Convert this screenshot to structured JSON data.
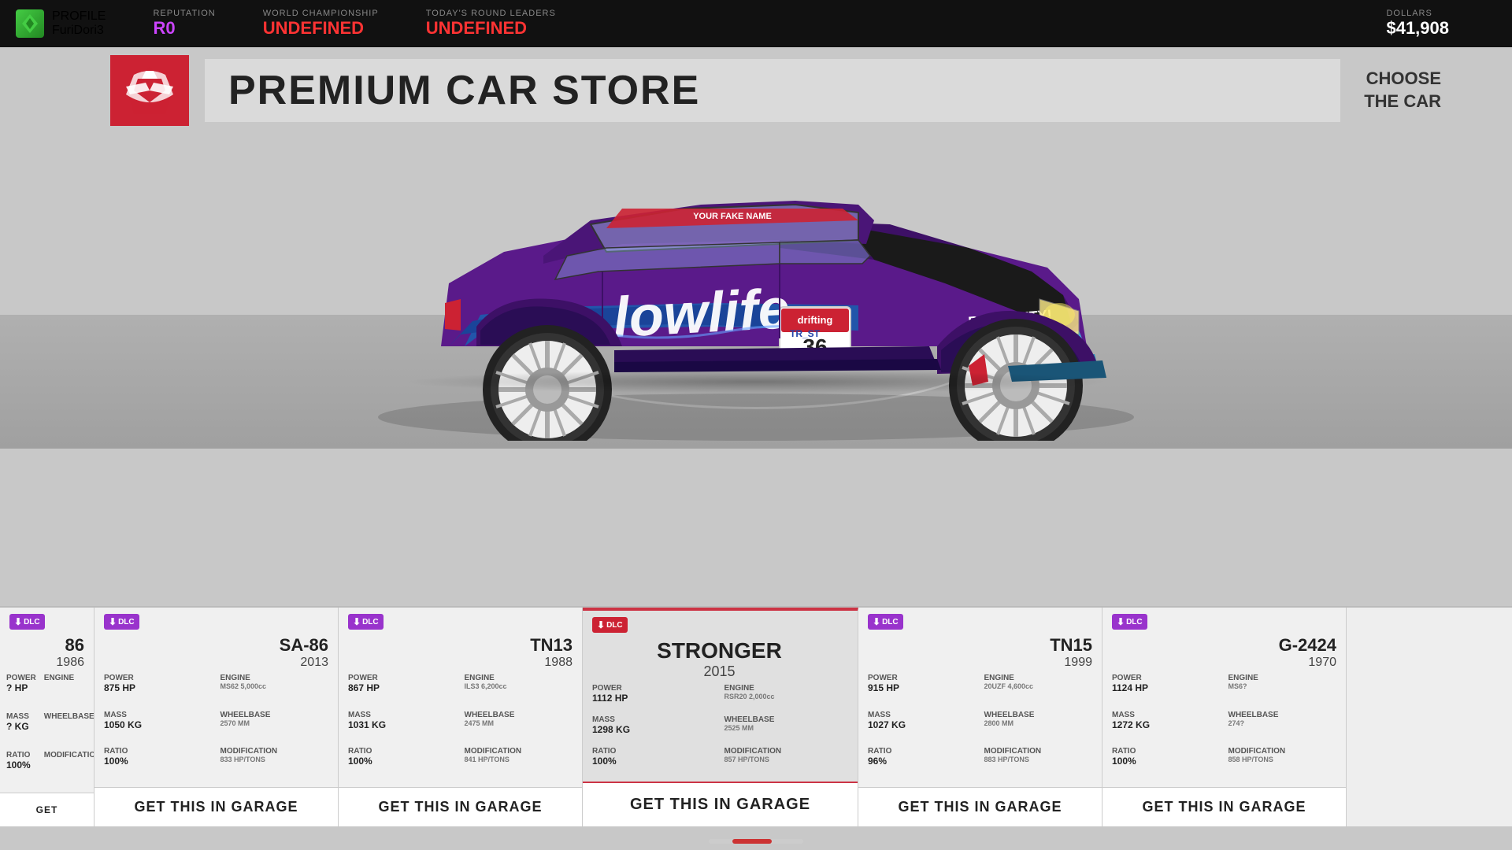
{
  "topbar": {
    "profile_label": "PROFILE",
    "profile_name": "FuriDori3",
    "reputation_label": "REPUTATION",
    "reputation_value": "R0",
    "championship_label": "WORLD CHAMPIONSHIP",
    "championship_value": "UNDEFINED",
    "round_leaders_label": "TODAY'S ROUND LEADERS",
    "round_leaders_value": "UNDEFINED",
    "dollars_label": "DOLLARS",
    "dollars_value": "$41,908"
  },
  "store": {
    "title": "PREMIUM CAR STORE",
    "choose_label": "CHOOSE\nTHE CAR"
  },
  "cars": [
    {
      "id": "partial-left",
      "name": "86",
      "year": "1986",
      "dlc": true,
      "power_label": "POWER",
      "power": "? HP",
      "mass_label": "MASS",
      "mass": "? KG",
      "ratio_label": "RATIO",
      "ratio": "100%",
      "engine_label": "ENGINE",
      "engine": "?",
      "wheelbase_label": "WHEELBASE",
      "wheelbase": "?",
      "modification_label": "MODIFICATION",
      "modification": "?",
      "get_label": "GET THIS IN GARAGE",
      "partial": "left"
    },
    {
      "id": "sa86",
      "name": "SA-86",
      "year": "2013",
      "dlc": true,
      "power_label": "POWER",
      "power": "875 HP",
      "mass_label": "MASS",
      "mass": "1050 KG",
      "ratio_label": "RATIO",
      "ratio": "100%",
      "engine_label": "ENGINE",
      "engine": "MS62 5,000cc",
      "wheelbase_label": "WHEELBASE",
      "wheelbase": "2570 MM",
      "modification_label": "MODIFICATION",
      "modification": "833 HP/TONS",
      "get_label": "GET THIS IN GARAGE"
    },
    {
      "id": "tn13",
      "name": "TN13",
      "year": "1988",
      "dlc": true,
      "power_label": "POWER",
      "power": "867 HP",
      "mass_label": "MASS",
      "mass": "1031 KG",
      "ratio_label": "RATIO",
      "ratio": "100%",
      "engine_label": "ENGINE",
      "engine": "ILS3 6,200cc",
      "wheelbase_label": "WHEELBASE",
      "wheelbase": "2475 MM",
      "modification_label": "MODIFICATION",
      "modification": "841 HP/TONS",
      "get_label": "GET THIS IN GARAGE"
    },
    {
      "id": "stronger",
      "name": "STRONGER",
      "year": "2015",
      "dlc": true,
      "power_label": "POWER",
      "power": "1112 HP",
      "mass_label": "MASS",
      "mass": "1298 KG",
      "ratio_label": "RATIO",
      "ratio": "100%",
      "engine_label": "ENGINE",
      "engine": "RSR20 2,000cc",
      "wheelbase_label": "WHEELBASE",
      "wheelbase": "2525 MM",
      "modification_label": "MODIFICATION",
      "modification": "857 HP/TONS",
      "get_label": "GET THIS IN GARAGE",
      "featured": true
    },
    {
      "id": "tn15",
      "name": "TN15",
      "year": "1999",
      "dlc": true,
      "power_label": "POWER",
      "power": "915 HP",
      "mass_label": "MASS",
      "mass": "1027 KG",
      "ratio_label": "RATIO",
      "ratio": "96%",
      "engine_label": "ENGINE",
      "engine": "20UZF 4,600cc",
      "wheelbase_label": "WHEELBASE",
      "wheelbase": "2800 MM",
      "modification_label": "MODIFICATION",
      "modification": "883 HP/TONS",
      "get_label": "GET THIS IN GARAGE"
    },
    {
      "id": "g2424",
      "name": "G-2424",
      "year": "1970",
      "dlc": true,
      "power_label": "POWER",
      "power": "1124 HP",
      "mass_label": "MASS",
      "mass": "1272 KG",
      "ratio_label": "RATIO",
      "ratio": "100%",
      "engine_label": "ENGINE",
      "engine": "MS6?",
      "wheelbase_label": "WHEELBASE",
      "wheelbase": "274?",
      "modification_label": "MODIFICATION",
      "modification": "858 HP/TONS",
      "get_label": "GET THIS IN GARAGE"
    }
  ]
}
